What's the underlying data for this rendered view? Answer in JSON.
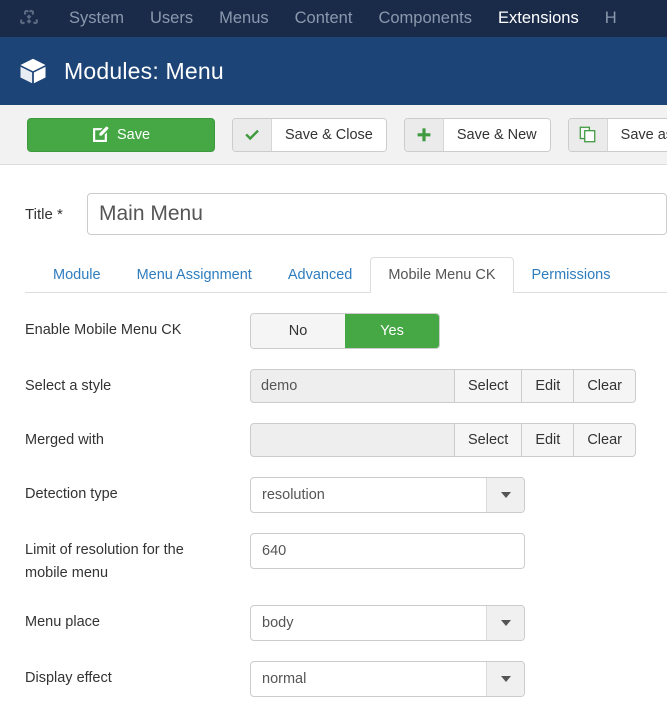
{
  "adminbar": {
    "logo_icon": "joomla-logo-icon",
    "items": [
      {
        "label": "System",
        "active": false
      },
      {
        "label": "Users",
        "active": false
      },
      {
        "label": "Menus",
        "active": false
      },
      {
        "label": "Content",
        "active": false
      },
      {
        "label": "Components",
        "active": false
      },
      {
        "label": "Extensions",
        "active": true
      },
      {
        "label": "H",
        "active": false
      }
    ]
  },
  "header": {
    "icon": "cube-icon",
    "title": "Modules: Menu"
  },
  "toolbar": {
    "save_label": "Save",
    "save_icon": "pencil-square-icon",
    "save_close_label": "Save & Close",
    "save_close_icon": "check-icon",
    "save_new_label": "Save & New",
    "save_new_icon": "plus-icon",
    "save_copy_label": "Save as Co",
    "save_copy_icon": "copy-icon"
  },
  "form": {
    "title_label": "Title *",
    "title_value": "Main Menu",
    "title_placeholder": ""
  },
  "tabs": [
    {
      "label": "Module",
      "active": false
    },
    {
      "label": "Menu Assignment",
      "active": false
    },
    {
      "label": "Advanced",
      "active": false
    },
    {
      "label": "Mobile Menu CK",
      "active": true
    },
    {
      "label": "Permissions",
      "active": false
    }
  ],
  "fields": {
    "enable": {
      "label": "Enable Mobile Menu CK",
      "option_no": "No",
      "option_yes": "Yes",
      "selected": "Yes"
    },
    "style": {
      "label": "Select a style",
      "value": "demo",
      "btn_select": "Select",
      "btn_edit": "Edit",
      "btn_clear": "Clear"
    },
    "merged": {
      "label": "Merged with",
      "value": "",
      "btn_select": "Select",
      "btn_edit": "Edit",
      "btn_clear": "Clear"
    },
    "detection": {
      "label": "Detection type",
      "value": "resolution"
    },
    "limit": {
      "label_line1": "Limit of resolution for the",
      "label_line2": "mobile menu",
      "value": "640"
    },
    "place": {
      "label": "Menu place",
      "value": "body"
    },
    "effect": {
      "label": "Display effect",
      "value": "normal"
    }
  },
  "colors": {
    "adminbar_bg": "#1a2b4a",
    "header_bg": "#1d4477",
    "accent_green": "#45a845",
    "link_blue": "#2f7dbf"
  }
}
